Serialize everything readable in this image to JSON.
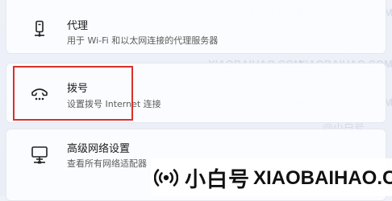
{
  "settings_items": [
    {
      "id": "proxy",
      "icon": "proxy-icon",
      "title": "代理",
      "description": "用于 Wi-Fi 和以太网连接的代理服务器"
    },
    {
      "id": "dialup",
      "icon": "dialup-icon",
      "title": "拨号",
      "description": "设置拨号 Internet 连接"
    },
    {
      "id": "advanced",
      "icon": "desktop-network-icon",
      "title": "高级网络设置",
      "description": "查看所有网络适配器"
    }
  ],
  "watermark": {
    "text_en": "XIAOBAIHAO.COM",
    "text_cn": "@小白号",
    "logo_cn": "小白号",
    "logo_en": "XIAOBAIHAO.COM"
  },
  "colors": {
    "highlight": "#d9302b",
    "background": "#eef1f8",
    "card": "#fbfcff"
  }
}
